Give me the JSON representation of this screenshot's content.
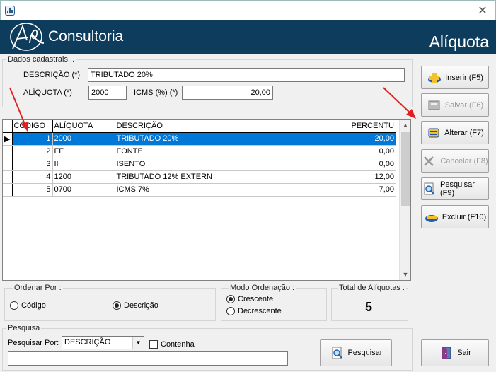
{
  "header": {
    "brand": "Consultoria",
    "title": "Alíquota"
  },
  "form": {
    "group_label": "Dados cadastrais...",
    "descricao_label": "DESCRIÇÃO (*)",
    "descricao_value": "TRIBUTADO 20%",
    "aliquota_label": "ALÍQUOTA (*)",
    "aliquota_value": "2000",
    "icms_label": "ICMS (%) (*)",
    "icms_value": "20,00"
  },
  "grid": {
    "columns": [
      "CÓDIGO",
      "ALÍQUOTA",
      "DESCRIÇÃO",
      "PERCENTU"
    ],
    "rows": [
      {
        "codigo": "1",
        "aliquota": "2000",
        "descricao": "TRIBUTADO 20%",
        "percentual": "20,00",
        "selected": true
      },
      {
        "codigo": "2",
        "aliquota": "FF",
        "descricao": "FONTE",
        "percentual": "0,00",
        "selected": false
      },
      {
        "codigo": "3",
        "aliquota": "II",
        "descricao": "ISENTO",
        "percentual": "0,00",
        "selected": false
      },
      {
        "codigo": "4",
        "aliquota": "1200",
        "descricao": "TRIBUTADO 12% EXTERN",
        "percentual": "12,00",
        "selected": false
      },
      {
        "codigo": "5",
        "aliquota": "0700",
        "descricao": "ICMS 7%",
        "percentual": "7,00",
        "selected": false
      }
    ]
  },
  "buttons": {
    "inserir": "Inserir (F5)",
    "salvar": "Salvar (F6)",
    "alterar": "Alterar (F7)",
    "cancelar": "Cancelar (F8)",
    "pesquisar_f9": "Pesquisar (F9)",
    "excluir": "Excluir (F10)",
    "sair": "Sair",
    "pesquisar": "Pesquisar"
  },
  "ordenar": {
    "label": "Ordenar Por :",
    "codigo": "Código",
    "descricao": "Descrição",
    "selected": "descricao"
  },
  "modo": {
    "label": "Modo Ordenação :",
    "crescente": "Crescente",
    "decrescente": "Decrescente",
    "selected": "crescente"
  },
  "total": {
    "label": "Total de Alíquotas :",
    "value": "5"
  },
  "pesquisa": {
    "group_label": "Pesquisa",
    "por_label": "Pesquisar Por:",
    "por_value": "DESCRIÇÃO",
    "contenha_label": "Contenha",
    "search_value": ""
  },
  "colors": {
    "header_bg": "#0e3c5c",
    "selection": "#0078d7",
    "annotation_arrow": "#e02020"
  }
}
